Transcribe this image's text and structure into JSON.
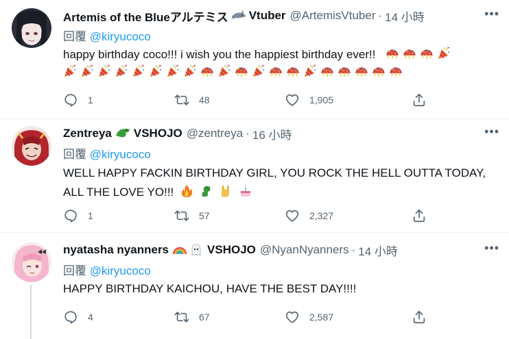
{
  "tweets": [
    {
      "name": "Artemis of the Blueアルテミス",
      "name_suffix": "Vtuber",
      "handle": "@ArtemisVtuber",
      "time": "14 小時",
      "reply_prefix": "回覆",
      "mention": "@kiryucoco",
      "text": "happy birthday coco!!! i wish you the happiest birthday ever!!",
      "replies": "1",
      "retweets": "48",
      "likes": "1,905"
    },
    {
      "name": "Zentreya",
      "name_suffix": "VSHOJO",
      "handle": "@zentreya",
      "time": "16 小時",
      "reply_prefix": "回覆",
      "mention": "@kiryucoco",
      "text_line1": "WELL HAPPY FACKIN BIRTHDAY GIRL, YOU ROCK THE HELL OUTTA TODAY,",
      "text_line2": "ALL THE LOVE YO!!!",
      "replies": "1",
      "retweets": "57",
      "likes": "2,327"
    },
    {
      "name": "nyatasha nyanners",
      "name_suffix": "VSHOJO",
      "handle": "@NyanNyanners",
      "time": "14 小時",
      "reply_prefix": "回覆",
      "mention": "@kiryucoco",
      "text": "HAPPY BIRTHDAY KAICHOU, HAVE THE BEST DAY!!!!",
      "replies": "4",
      "retweets": "67",
      "likes": "2,587"
    }
  ],
  "time_separator": "·",
  "colors": {
    "accent": "#1d9bf0",
    "muted": "#536471",
    "divider": "#eff3f4"
  },
  "icons": [
    "reply-icon",
    "retweet-icon",
    "like-icon",
    "share-icon",
    "more-icon",
    "shark-emoji",
    "dragon-emoji",
    "party-popper-emoji",
    "confetti-ball-emoji",
    "fire-emoji",
    "rock-on-emoji",
    "birthday-cake-emoji",
    "rainbow-emoji",
    "ghost-emoji"
  ]
}
